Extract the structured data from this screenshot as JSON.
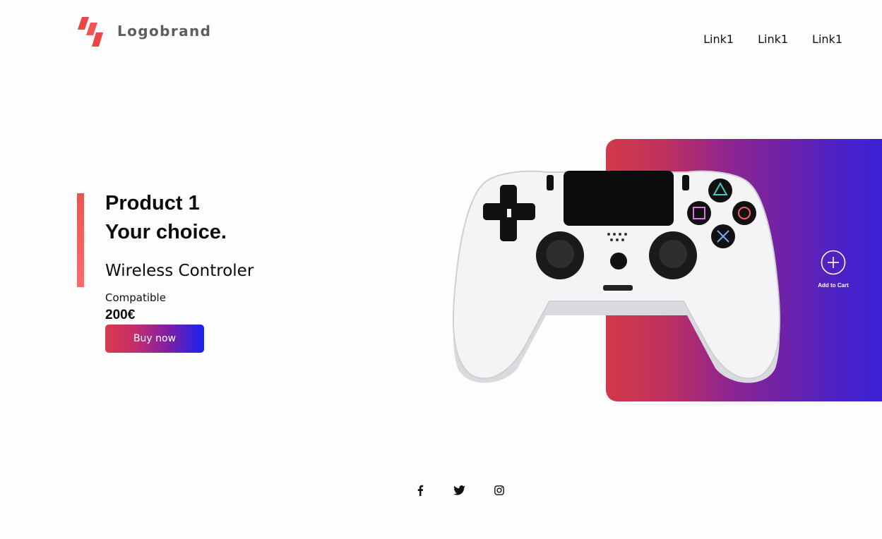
{
  "brand": {
    "name": "Logobrand",
    "color": "#ef4444"
  },
  "nav": {
    "items": [
      "Link1",
      "Link1",
      "Link1"
    ]
  },
  "hero": {
    "title_line1": "Product 1",
    "title_line2": "Your choice.",
    "subtitle": "Wireless Controler",
    "compat": "Compatible",
    "price": "200€",
    "buy_label": "Buy now"
  },
  "product": {
    "image_icon": "gamepad-image",
    "add_label": "Add to Cart"
  },
  "footer": {
    "socials": [
      "facebook-icon",
      "twitter-icon",
      "instagram-icon"
    ]
  },
  "colors": {
    "accent_red": "#e04050",
    "accent_blue": "#1a22f0",
    "panel_purple": "#3c20d4"
  }
}
